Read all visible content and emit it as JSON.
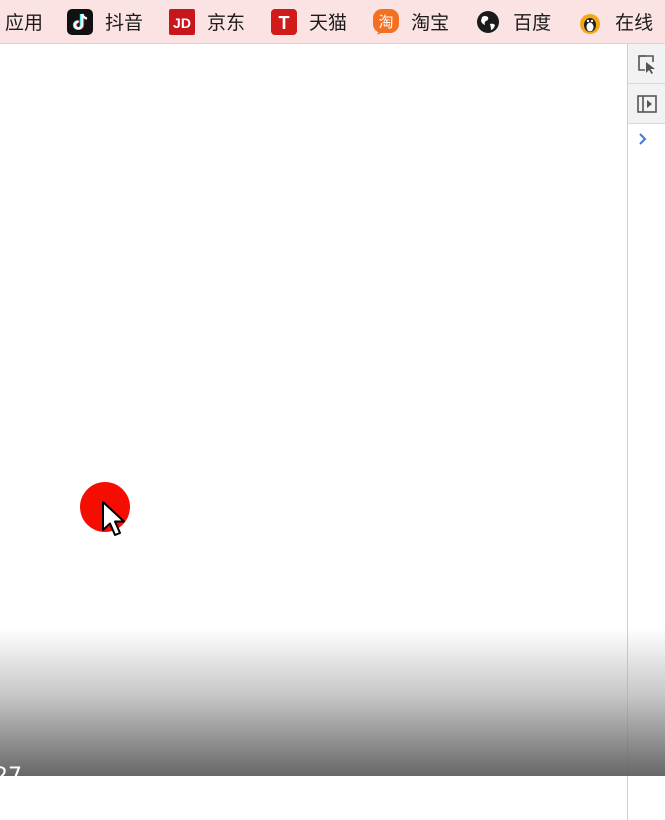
{
  "bookmarks": {
    "items": [
      {
        "label": "应用",
        "icon": "apps-icon"
      },
      {
        "label": "抖音",
        "icon": "douyin-icon"
      },
      {
        "label": "京东",
        "icon": "jd-icon",
        "icon_text": "JD",
        "color": "#c8161d"
      },
      {
        "label": "天猫",
        "icon": "tmall-icon",
        "icon_text": "T",
        "color": "#d11a1a"
      },
      {
        "label": "淘宝",
        "icon": "taobao-icon",
        "icon_text": "淘",
        "color": "#f37021"
      },
      {
        "label": "百度",
        "icon": "globe-icon"
      },
      {
        "label": "在线",
        "icon": "penguin-icon"
      }
    ]
  },
  "canvas": {
    "dot_color": "#f40d00",
    "corner_text": "27"
  },
  "devtools": {
    "buttons": [
      {
        "icon": "inspect-element-icon"
      },
      {
        "icon": "toggle-device-icon"
      }
    ],
    "expand_icon": "chevron-right-icon",
    "accent": "#3c7bd9"
  },
  "colors": {
    "bookmarks_bar_bg": "#fbe3e3"
  }
}
